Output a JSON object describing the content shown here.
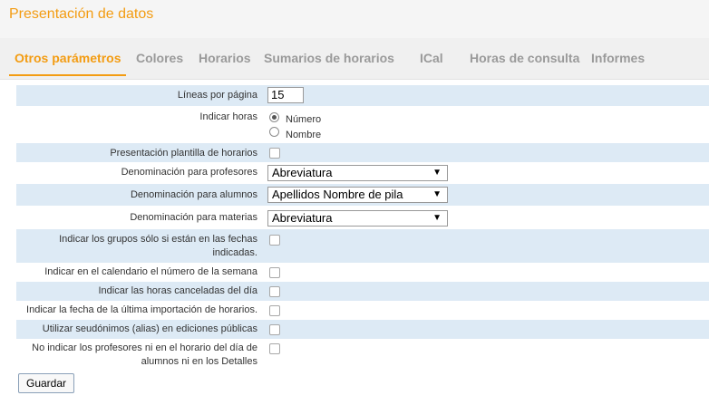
{
  "header": {
    "title": "Presentación de datos"
  },
  "tabs": [
    {
      "label": "Otros parámetros"
    },
    {
      "label": "Colores"
    },
    {
      "label": "Horarios"
    },
    {
      "label": "Sumarios de horarios"
    },
    {
      "label": "ICal"
    },
    {
      "label": "Horas de consulta"
    },
    {
      "label": "Informes"
    }
  ],
  "form": {
    "lineas_label": "Líneas por página",
    "lineas_value": "15",
    "horas_label": "Indicar horas",
    "horas_opt1": "Número",
    "horas_opt2": "Nombre",
    "plantilla_label": "Presentación plantilla de horarios",
    "profesores_label": "Denominación para profesores",
    "profesores_value": "Abreviatura",
    "alumnos_label": "Denominación para alumnos",
    "alumnos_value": "Apellidos Nombre de pila",
    "materias_label": "Denominación para materias",
    "materias_value": "Abreviatura",
    "grupos_label_1": "Indicar los grupos sólo si están en las fechas",
    "grupos_label_2": "indicadas.",
    "semana_label": "Indicar en el calendario el número de la semana",
    "canceladas_label": "Indicar las horas canceladas del día",
    "importacion_label": "Indicar la fecha de la última importación de horarios.",
    "alias_label": "Utilizar seudónimos (alias) en ediciones públicas",
    "noprof_label_1": "No indicar los profesores ni en el horario del día de",
    "noprof_label_2": "alumnos ni en los Detalles",
    "save_label": "Guardar"
  }
}
